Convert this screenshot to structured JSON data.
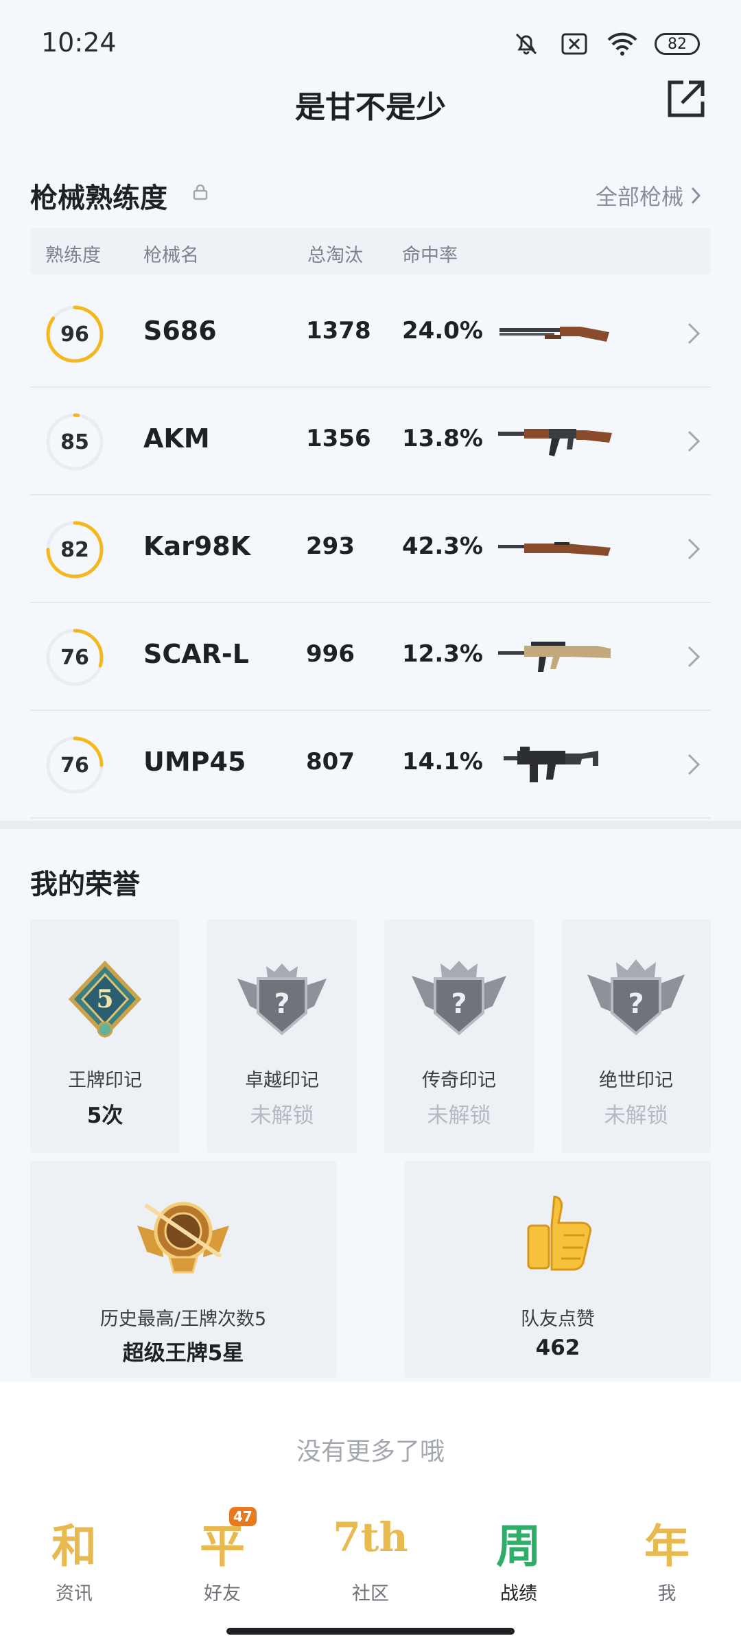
{
  "status_bar": {
    "time": "10:24",
    "battery": "82"
  },
  "header": {
    "title": "是甘不是少"
  },
  "weapons": {
    "section_title": "枪械熟练度",
    "all_link": "全部枪械",
    "columns": [
      "熟练度",
      "枪械名",
      "总淘汰",
      "命中率"
    ],
    "rows": [
      {
        "level": "96",
        "progress": 0.85,
        "name": "S686",
        "kills": "1378",
        "rate": "24.0%",
        "gun_icon": "shotgun-icon"
      },
      {
        "level": "85",
        "progress": 0.02,
        "name": "AKM",
        "kills": "1356",
        "rate": "13.8%",
        "gun_icon": "assault-rifle-icon"
      },
      {
        "level": "82",
        "progress": 0.75,
        "name": "Kar98K",
        "kills": "293",
        "rate": "42.3%",
        "gun_icon": "sniper-rifle-icon"
      },
      {
        "level": "76",
        "progress": 0.3,
        "name": "SCAR-L",
        "kills": "996",
        "rate": "12.3%",
        "gun_icon": "scar-rifle-icon"
      },
      {
        "level": "76",
        "progress": 0.25,
        "name": "UMP45",
        "kills": "807",
        "rate": "14.1%",
        "gun_icon": "smg-icon"
      }
    ]
  },
  "honor": {
    "section_title": "我的荣誉",
    "badges": [
      {
        "label": "王牌印记",
        "value": "5次",
        "badge_text": "5",
        "locked": false
      },
      {
        "label": "卓越印记",
        "value": "未解锁",
        "badge_text": "?",
        "locked": true
      },
      {
        "label": "传奇印记",
        "value": "未解锁",
        "badge_text": "?",
        "locked": true
      },
      {
        "label": "绝世印记",
        "value": "未解锁",
        "badge_text": "?",
        "locked": true
      }
    ],
    "highest": {
      "label": "历史最高/王牌次数5",
      "value": "超级王牌5星"
    },
    "likes": {
      "label": "队友点赞",
      "value": "462"
    }
  },
  "footer_note": "没有更多了哦",
  "tabs": [
    {
      "glyph": "和",
      "label": "资讯"
    },
    {
      "glyph": "平",
      "label": "好友",
      "count": "47"
    },
    {
      "glyph": "7th",
      "label": "社区"
    },
    {
      "glyph": "周",
      "label": "战绩",
      "active": true
    },
    {
      "glyph": "年",
      "label": "我"
    }
  ],
  "colors": {
    "accent": "#f5b81c",
    "ring_track": "#e9ecf1",
    "tab_gold": "#e8b94e"
  }
}
